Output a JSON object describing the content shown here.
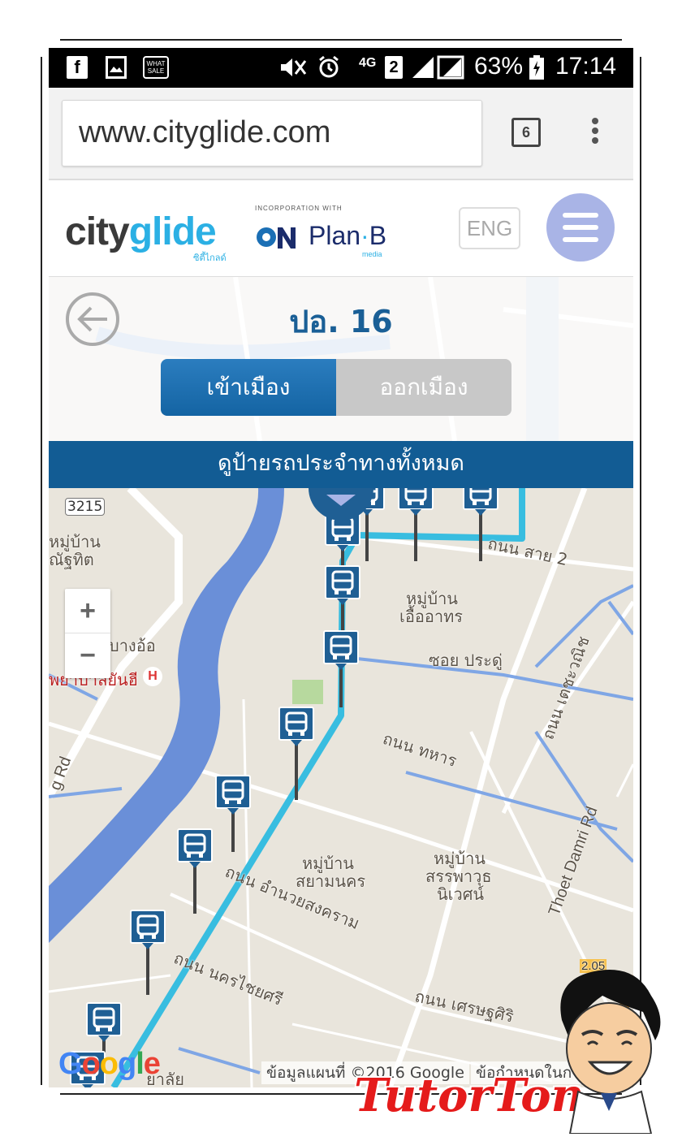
{
  "status_bar": {
    "network": "4G",
    "sim": "2",
    "battery": "63%",
    "time": "17:14",
    "sale_badge_top": "WHAT",
    "sale_badge_bottom": "SALE"
  },
  "browser": {
    "url": "www.cityglide.com",
    "tab_count": "6"
  },
  "header": {
    "logo_city": "city",
    "logo_glide": "glide",
    "logo_thai": "ซิตี้ไกลด์",
    "partner_caption": "INCORPORATION WITH",
    "partner_name": "Plan",
    "partner_letter": "B",
    "partner_media": "media",
    "lang_button": "ENG"
  },
  "route": {
    "title": "ปอ. 16",
    "tab_inbound": "เข้าเมือง",
    "tab_outbound": "ออกเมือง",
    "all_stops_link": "ดูป้ายรถประจำทางทั้งหมด"
  },
  "map": {
    "zoom_in": "+",
    "zoom_out": "−",
    "hospital_marker": "H",
    "labels": [
      {
        "text": "3215"
      },
      {
        "text": "หมู่บ้าน"
      },
      {
        "text": "ณัฐทิต"
      },
      {
        "text": "บางอ้อ"
      },
      {
        "text": "พยาบาลยันฮี"
      },
      {
        "text": "ถนน สาย 2"
      },
      {
        "text": "หมู่บ้าน"
      },
      {
        "text": "เอื้ออาทร"
      },
      {
        "text": "ซอย ประดู่"
      },
      {
        "text": "ถนน เตชะวณิช"
      },
      {
        "text": "ถนน ทหาร"
      },
      {
        "text": "หมู่บ้าน"
      },
      {
        "text": "สยามนคร"
      },
      {
        "text": "หมู่บ้าน"
      },
      {
        "text": "สรรพาวุธ"
      },
      {
        "text": "นิเวศน์"
      },
      {
        "text": "Thoet Damri Rd"
      },
      {
        "text": "ถนน อำนวยสงคราม"
      },
      {
        "text": "ถนน นครไชยศรี"
      },
      {
        "text": "ถนน เศรษฐศิริ"
      },
      {
        "text": "g Rd"
      },
      {
        "text": "2.05"
      },
      {
        "text": "ยาลัย"
      }
    ],
    "google": [
      "G",
      "o",
      "o",
      "g",
      "l",
      "e"
    ],
    "credit": "ข้อมูลแผนที่ ©2016 Google",
    "terms": "ข้อกำหนดในการ"
  },
  "watermark": "TutorTon",
  "colors": {
    "route_line": "#38bde0",
    "bus_stop": "#1f5f94",
    "header_blue": "#125c94",
    "segment_active": "#1c6fb0",
    "river": "#6a8fd8",
    "canal": "#7fa6e5"
  }
}
